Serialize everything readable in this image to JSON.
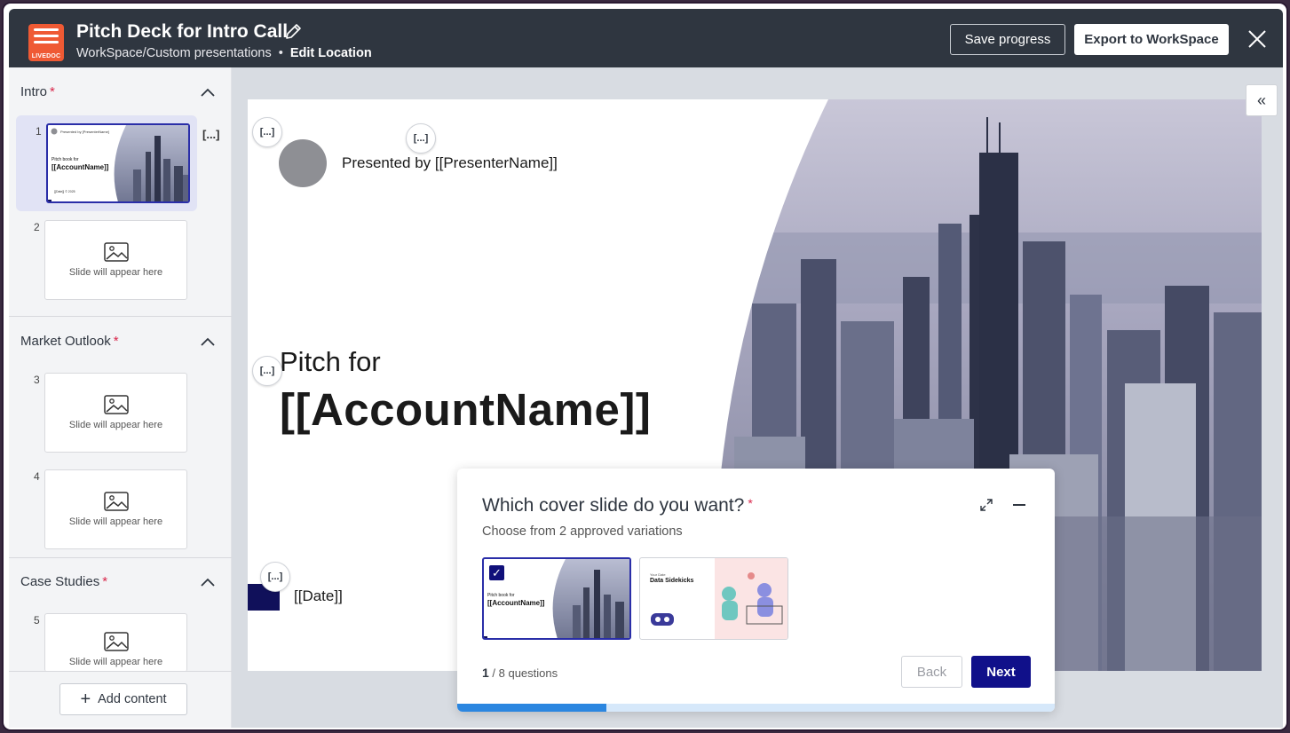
{
  "header": {
    "title": "Pitch Deck for Intro Call",
    "breadcrumb_path": "WorkSpace/Custom presentations",
    "breadcrumb_sep": "•",
    "breadcrumb_action": "Edit Location",
    "logo_label": "LIVEDOC",
    "save_label": "Save progress",
    "export_label": "Export to WorkSpace"
  },
  "sidebar": {
    "sections": [
      {
        "title": "Intro",
        "required": "*"
      },
      {
        "title": "Market Outlook",
        "required": "*"
      },
      {
        "title": "Case Studies",
        "required": "*"
      }
    ],
    "slide_numbers": [
      "1",
      "2",
      "3",
      "4",
      "5"
    ],
    "placeholder_text": "Slide will appear here",
    "tag_label": "[...]",
    "add_content_label": "Add content",
    "thumb1": {
      "small_top": "Presented by [PresenterName]",
      "pitch": "Pitch book for",
      "account": "[[AccountName]]",
      "date": "[[Date]] © 2025"
    }
  },
  "slide": {
    "presenter_text": "Presented by [[PresenterName]]",
    "pitch_for": "Pitch for",
    "account_name": "[[AccountName]]",
    "date": "[[Date]]",
    "tag_label": "[...]"
  },
  "question": {
    "title": "Which cover slide do you want?",
    "required": "*",
    "subtitle": "Choose from 2 approved variations",
    "current": "1",
    "total": " / 8 questions",
    "progress": 0.25,
    "back_label": "Back",
    "next_label": "Next",
    "option2": {
      "small_top": "Your Date",
      "title": "Data Sidekicks"
    }
  },
  "colors": {
    "header_bg": "#2f3640",
    "accent": "#10108a",
    "required": "#d9264a",
    "logo": "#ef5a34",
    "progress": "#2b86e0"
  }
}
